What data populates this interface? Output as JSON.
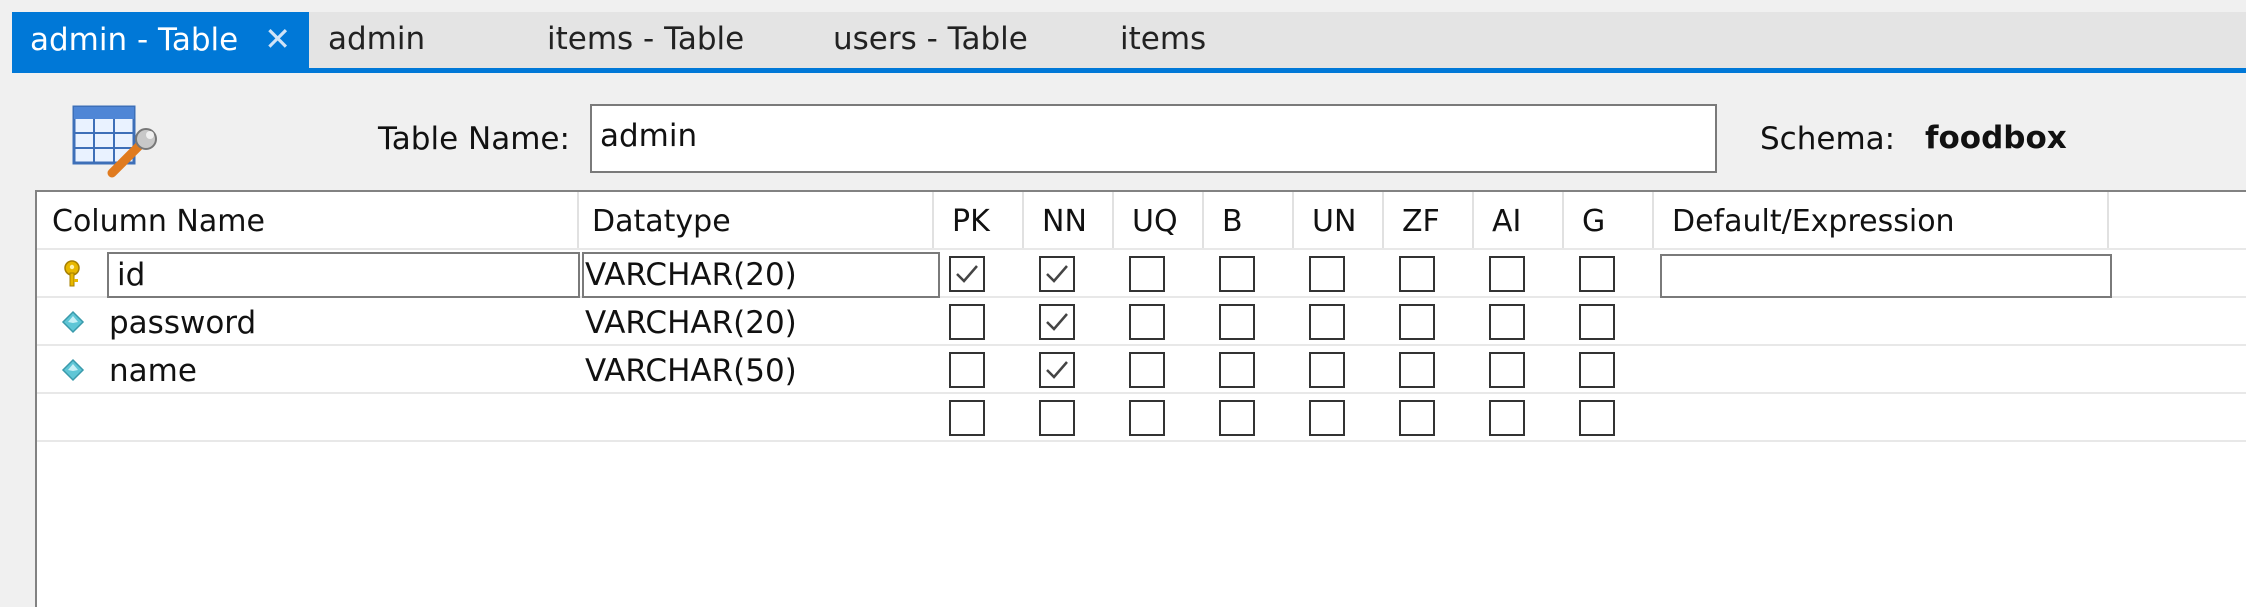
{
  "tabs": [
    {
      "label": "admin - Table",
      "active": true
    },
    {
      "label": "admin"
    },
    {
      "label": "items - Table"
    },
    {
      "label": "users - Table"
    },
    {
      "label": "items"
    }
  ],
  "editor": {
    "table_name_label": "Table Name:",
    "table_name_value": "admin",
    "schema_label": "Schema:",
    "schema_value": "foodbox"
  },
  "grid": {
    "headers": [
      "Column Name",
      "Datatype",
      "PK",
      "NN",
      "UQ",
      "B",
      "UN",
      "ZF",
      "AI",
      "G",
      "Default/Expression"
    ],
    "rows": [
      {
        "icon": "key",
        "name": "id",
        "datatype": "VARCHAR(20)",
        "flags": {
          "PK": true,
          "NN": true,
          "UQ": false,
          "B": false,
          "UN": false,
          "ZF": false,
          "AI": false,
          "G": false
        },
        "editing": true
      },
      {
        "icon": "diamond",
        "name": "password",
        "datatype": "VARCHAR(20)",
        "flags": {
          "PK": false,
          "NN": true,
          "UQ": false,
          "B": false,
          "UN": false,
          "ZF": false,
          "AI": false,
          "G": false
        }
      },
      {
        "icon": "diamond",
        "name": "name",
        "datatype": "VARCHAR(50)",
        "flags": {
          "PK": false,
          "NN": true,
          "UQ": false,
          "B": false,
          "UN": false,
          "ZF": false,
          "AI": false,
          "G": false
        }
      },
      {
        "icon": "",
        "name": "",
        "datatype": "",
        "flags": {
          "PK": false,
          "NN": false,
          "UQ": false,
          "B": false,
          "UN": false,
          "ZF": false,
          "AI": false,
          "G": false
        }
      }
    ]
  },
  "colors": {
    "accent": "#0078d7",
    "key_icon": "#e8b800",
    "diamond_icon": "#5fc6d6"
  }
}
